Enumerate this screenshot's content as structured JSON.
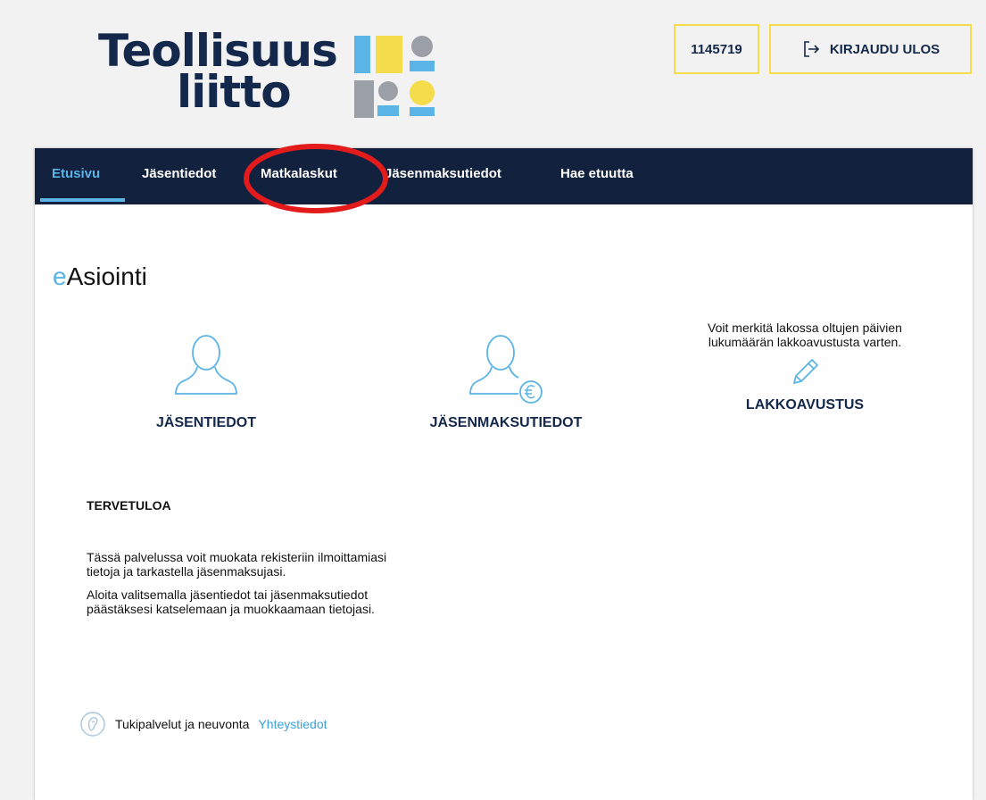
{
  "brand": {
    "line1": "Teollisuus",
    "line2": "liitto",
    "colors": {
      "navy": "#14284b",
      "blue": "#5ab4e6",
      "yellow": "#f5dc4b",
      "grey": "#9aa0a6"
    }
  },
  "header": {
    "member_id": "1145719",
    "logout_label": "KIRJAUDU ULOS",
    "logout_icon": "logout-icon"
  },
  "nav": {
    "items": [
      {
        "label": "Etusivu",
        "active": true
      },
      {
        "label": "Jäsentiedot"
      },
      {
        "label": "Matkalaskut"
      },
      {
        "label": "Jäsenmaksutiedot"
      },
      {
        "label": "Hae etuutta"
      }
    ]
  },
  "page": {
    "title_prefix": "e",
    "title_rest": "Asiointi"
  },
  "tiles": {
    "member": {
      "label": "JÄSENTIEDOT",
      "icon": "person-icon"
    },
    "fees": {
      "label": "JÄSENMAKSUTIEDOT",
      "icon": "person-euro-icon"
    },
    "strike": {
      "label": "LAKKOAVUSTUS",
      "icon": "pencil-icon",
      "description_line1": "Voit merkitä lakossa oltujen päivien",
      "description_line2": "lukumäärän lakkoavustusta varten."
    }
  },
  "welcome": {
    "title": "TERVETULOA",
    "p1_line1": "Tässä palvelussa voit muokata rekisteriin ilmoittamiasi",
    "p1_line2": "tietoja ja tarkastella jäsenmaksujasi.",
    "p2_line1": "Aloita valitsemalla jäsentiedot tai jäsenmaksutiedot",
    "p2_line2": "päästäksesi katselemaan ja muokkaamaan tietojasi."
  },
  "support": {
    "text": "Tukipalvelut ja neuvonta",
    "link": "Yhteystiedot",
    "icon": "ear-icon"
  },
  "annotation": {
    "color": "#e31b1b",
    "shape": "ellipse",
    "target": "Matkalaskut"
  }
}
